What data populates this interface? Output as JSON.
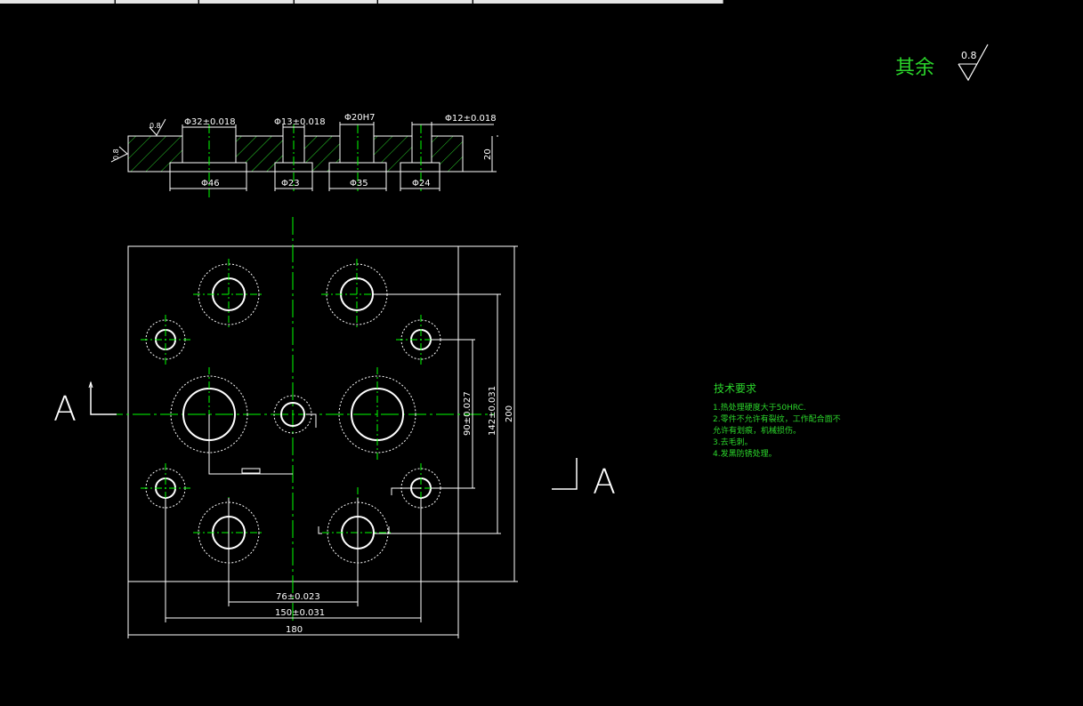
{
  "colors": {
    "background": "#000000",
    "geometry": "#ffffff",
    "centerline": "#00ff00",
    "text": "#2bd62b"
  },
  "roughness": {
    "label": "其余",
    "value": "0.8"
  },
  "section_view": {
    "dims_top": [
      "Φ32±0.018",
      "Φ13±0.018",
      "Φ20H7",
      "Φ12±0.018"
    ],
    "dims_bottom": [
      "Φ46",
      "Φ23",
      "Φ35",
      "Φ24"
    ],
    "thickness": "20",
    "roughness_left_value": "0.8",
    "roughness_left_side": "0.8"
  },
  "plan_view": {
    "section_marker_left": "A",
    "section_marker_right": "A",
    "dim_76": "76±0.023",
    "dim_150": "150±0.031",
    "dim_180": "180",
    "dim_90": "90±0.027",
    "dim_142": "142±0.031",
    "dim_200": "200"
  },
  "tech_requirements": {
    "title": "技术要求",
    "lines": [
      "1.热处理硬度大于50HRC.",
      "2.零件不允许有裂纹，工作配合面不",
      "允许有划痕，机械损伤。",
      "3.去毛刺。",
      "4.发黑防锈处理。"
    ]
  }
}
